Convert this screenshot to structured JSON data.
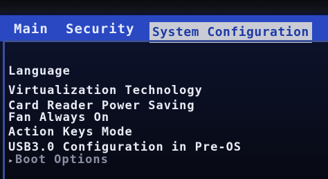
{
  "menu": {
    "tabs": [
      {
        "label": "Main"
      },
      {
        "label": "Security"
      },
      {
        "label": "System Configuration"
      }
    ],
    "active_index": 2
  },
  "items": [
    {
      "label": "Language"
    },
    {
      "label": "Virtualization Technology"
    },
    {
      "label": "Card Reader Power Saving"
    },
    {
      "label": "Fan Always On"
    },
    {
      "label": "Action Keys Mode"
    },
    {
      "label": "USB3.0 Configuration in Pre-OS"
    },
    {
      "label": "Boot Options",
      "submenu_marker": "▸"
    }
  ],
  "colors": {
    "menubar": "#2a48c2",
    "active_tab_bg": "#c9ccd4",
    "active_tab_text": "#1e3aa6",
    "text": "#e9ecf5",
    "background": "#0b0f22"
  }
}
